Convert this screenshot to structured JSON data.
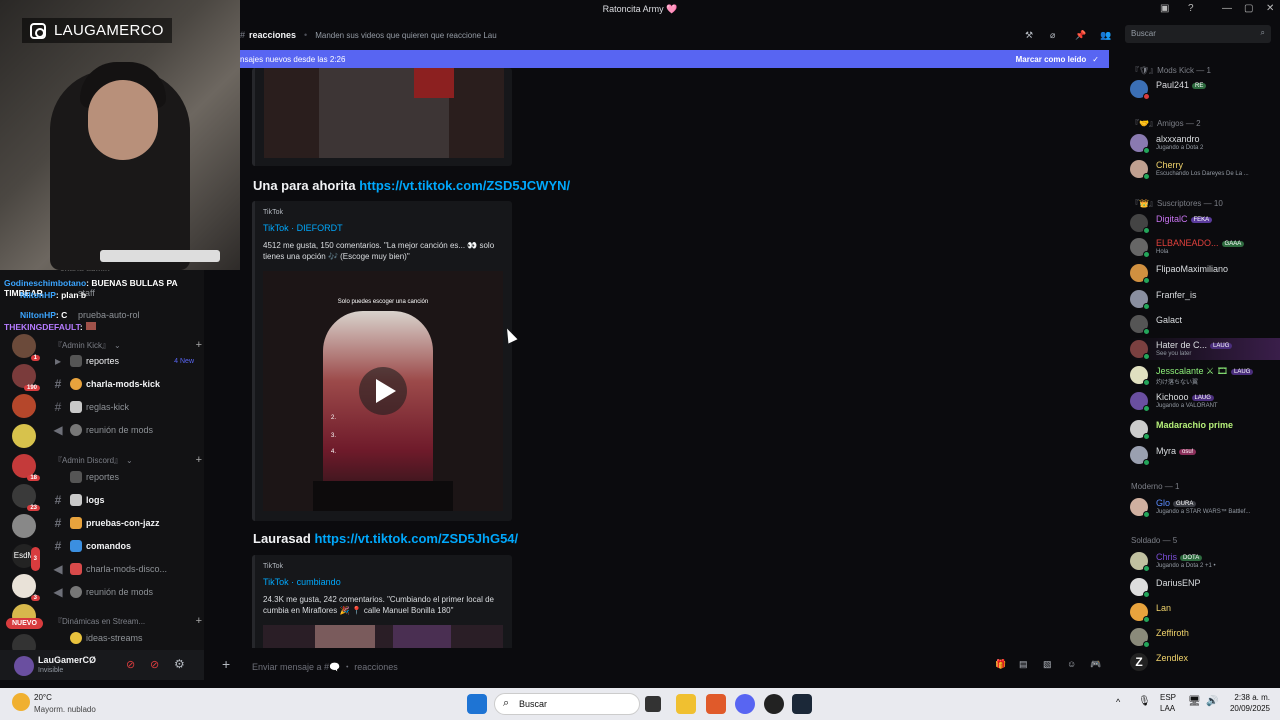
{
  "window": {
    "title": "Ratoncita Army 🩷"
  },
  "webcam": {
    "handle": "LAUGAMERCO"
  },
  "overlay_chat": [
    {
      "user": "Godineschimbotano",
      "text": ": BUENAS BULLAS PA TIMBEAR",
      "color": "#3ba5ff"
    },
    {
      "user": "NiltonHP",
      "text": ": plan b",
      "color": "#3ba5ff"
    },
    {
      "user": "NiltonHP",
      "text": ": C",
      "color": "#3ba5ff"
    },
    {
      "user": "THEKINGDEFAULT",
      "text": ":",
      "color": "#b57bff"
    }
  ],
  "channels": {
    "ghost": {
      "top": "charla-admin",
      "staff": "staff",
      "prueba": "prueba-auto-rol"
    },
    "cat_admin_kick": "『Admin Kick』",
    "reportes": "reportes",
    "reportes_new": "4 New",
    "charla_mods_kick": "charla-mods-kick",
    "reglas_kick": "reglas-kick",
    "reunion_mods": "reunión de mods",
    "cat_admin_discord": "『Admin Discord』",
    "reportes2": "reportes",
    "logs": "logs",
    "pruebas_con_jazz": "pruebas-con-jazz",
    "comandos": "comandos",
    "charla_mods_disco": "charla-mods-disco...",
    "reunion_mods2": "reunión de mods",
    "cat_dinamicas": "『Dinámicas en Stream...",
    "ideas_streams": "ideas-streams"
  },
  "servers": {
    "badges": [
      "1",
      "190",
      "18",
      "23",
      "3",
      "3"
    ],
    "esdm": "EsdM",
    "nuevo": "NUEVO"
  },
  "user": {
    "name": "LauGamerCØ",
    "status": "Invisible"
  },
  "header": {
    "channel": "reacciones",
    "topic": "Manden sus videos que quieren que reaccione Lau",
    "search_placeholder": "Buscar"
  },
  "new_messages_bar": {
    "text": "nsajes nuevos desde las 2:26",
    "action": "Marcar como leído"
  },
  "messages": [
    {
      "prefix": "Una para ahorita",
      "link": "https://vt.tiktok.com/ZSD5JCWYN/",
      "embed": {
        "provider": "TikTok",
        "title": "TikTok · DIEFORDT",
        "desc": "4512 me gusta, 150 comentarios. \"La mejor canción es... 👀 solo tienes una opción 🎶 (Escoge muy bien)\"",
        "video_caption": "Solo puedes escoger una canción",
        "video_list": [
          "2.",
          "3.",
          "4."
        ]
      }
    },
    {
      "prefix": "Laurasad",
      "link": "https://vt.tiktok.com/ZSD5JhG54/",
      "embed": {
        "provider": "TikTok",
        "title": "TikTok · cumbiando",
        "desc": "24.3K me gusta, 242 comentarios. \"Cumbiando el primer local de cumbia en Miraflores 🎉 📍 calle Manuel Bonilla 180\""
      }
    }
  ],
  "composer": {
    "placeholder": "Enviar mensaje a #🗨️ ・ reacciones"
  },
  "members": {
    "groups": [
      {
        "label": "『🛡』Mods Kick — 1"
      },
      {
        "label": "『🤝』Amigos — 2"
      },
      {
        "label": "『👑』Suscriptores — 10"
      },
      {
        "label": "Moderno — 1"
      },
      {
        "label": "Soldado — 5"
      }
    ],
    "list": [
      {
        "name": "Paul241",
        "tag": "RE",
        "tagcolor": "#3ba55d",
        "color": "#dbdee1",
        "activity": ""
      },
      {
        "name": "alxxxandro",
        "tag": "",
        "color": "#dbdee1",
        "activity": "Jugando a Dota 2"
      },
      {
        "name": "Cherry",
        "tag": "",
        "color": "#f0d36b",
        "activity": "Escuchando Los Dareyes De La ..."
      },
      {
        "name": "DigitalC",
        "tag": "FEKA",
        "tagcolor": "#7b4fd6",
        "color": "#c774f0",
        "activity": ""
      },
      {
        "name": "ELBANEADO...",
        "tag": "GAAA",
        "tagcolor": "#2e9e4f",
        "color": "#e0403c",
        "activity": "Hola"
      },
      {
        "name": "FlipaoMaximiliano",
        "tag": "",
        "color": "#dbdee1",
        "activity": ""
      },
      {
        "name": "Franfer_is",
        "tag": "",
        "color": "#dbdee1",
        "activity": ""
      },
      {
        "name": "Galact",
        "tag": "",
        "color": "#dbdee1",
        "activity": ""
      },
      {
        "name": "Hater de C...",
        "tag": "LAUG",
        "tagcolor": "#6d3fb5",
        "color": "#dbdee1",
        "activity": "See you later"
      },
      {
        "name": "Jesscalante ⚔ 🎞",
        "tag": "LAUG",
        "tagcolor": "#6d3fb5",
        "color": "#8ef07a",
        "activity": "灼け落ちない翼"
      },
      {
        "name": "Kichooo",
        "tag": "LAUG",
        "tagcolor": "#6d3fb5",
        "color": "#dbdee1",
        "activity": "Jugando a VALORANT"
      },
      {
        "name": "Madarachio prime",
        "tag": "",
        "color": "#b6f07a",
        "activity": ""
      },
      {
        "name": "Myra",
        "tag": "osu!",
        "tagcolor": "#c04a7d",
        "color": "#dbdee1",
        "activity": ""
      },
      {
        "name": "Glo",
        "tag": "GURA",
        "tagcolor": "#3a3c43",
        "color": "#5b8cff",
        "activity": "Jugando a STAR WARS™ Battlef..."
      },
      {
        "name": "Chris",
        "tag": "DOTA",
        "tagcolor": "#2e9e4f",
        "color": "#7b4fd6",
        "activity": "Jugando a Dota 2 +1 •"
      },
      {
        "name": "DariusENP",
        "tag": "",
        "color": "#dbdee1",
        "activity": ""
      },
      {
        "name": "Lan",
        "tag": "",
        "color": "#f0d36b",
        "activity": ""
      },
      {
        "name": "Zeffiroth",
        "tag": "",
        "color": "#f0d36b",
        "activity": ""
      },
      {
        "name": "Zendlex",
        "tag": "",
        "color": "#f0d36b",
        "activity": ""
      }
    ]
  },
  "taskbar": {
    "weather_temp": "20°C",
    "weather_desc": "Mayorm. nublado",
    "search": "Buscar",
    "lang1": "ESP",
    "lang2": "LAA",
    "time": "2:38 a. m.",
    "date": "20/09/2025"
  },
  "colors": {
    "accent": "#5865f2",
    "link": "#00a8fc",
    "online": "#23a55a"
  }
}
